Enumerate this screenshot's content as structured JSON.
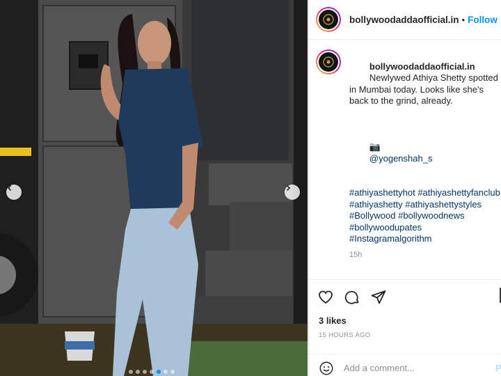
{
  "post": {
    "username": "bollywoodaddaofficial.in",
    "separator": "•",
    "follow_label": "Follow",
    "more_label": "•••",
    "avatar_icon": "bollywood-adda-logo",
    "caption": {
      "username": "bollywoodaddaofficial.in",
      "text": "Newlywed Athiya Shetty spotted in Mumbai today. Looks like she's back to the grind, already.",
      "credit_emoji": "📷",
      "credit_handle": "@yogenshah_s",
      "hashtags": [
        "#athiyashettyhot",
        "#athiyashettyfanclub",
        "#athiyashetty",
        "#athiyashettystyles",
        "#Bollywood",
        "#bollywoodnews",
        "#bollywoodupates",
        "#Instagramalgorithm"
      ],
      "time_ago": "15h"
    },
    "likes": "3 likes",
    "posted": "15 HOURS AGO",
    "comment_placeholder": "Add a comment...",
    "post_label": "Post"
  },
  "media": {
    "carousel_position": {
      "current": 5,
      "total": 7
    },
    "icons": [
      "chevron-left-icon",
      "chevron-right-icon"
    ]
  },
  "colors": {
    "accent": "#0095f6",
    "hashtag": "#00376b",
    "muted": "#8e8e8e"
  }
}
